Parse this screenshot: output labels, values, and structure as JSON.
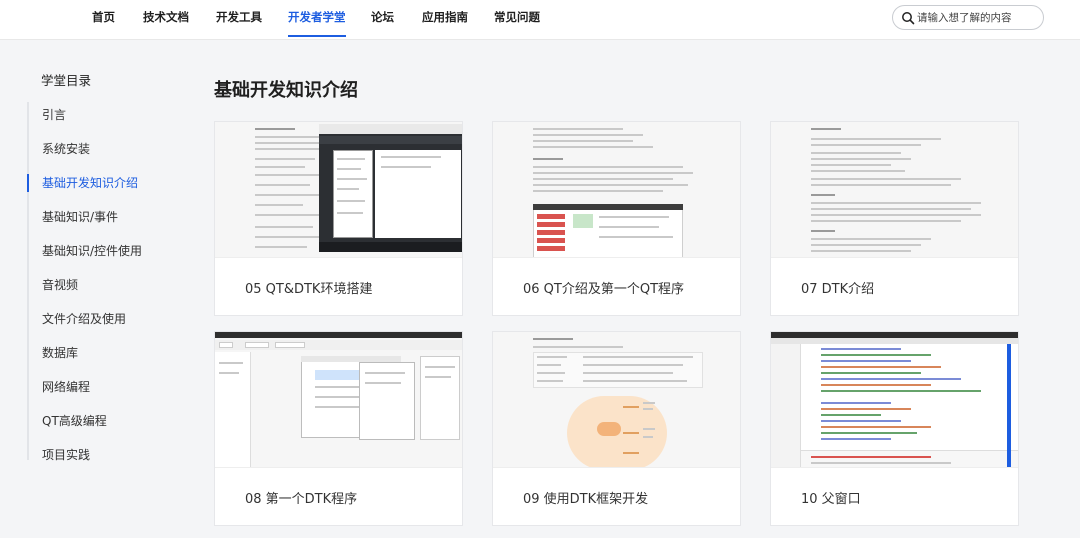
{
  "nav": {
    "items": [
      {
        "label": "首页",
        "active": false
      },
      {
        "label": "技术文档",
        "active": false
      },
      {
        "label": "开发工具",
        "active": false
      },
      {
        "label": "开发者学堂",
        "active": true
      },
      {
        "label": "论坛",
        "active": false
      },
      {
        "label": "应用指南",
        "active": false
      },
      {
        "label": "常见问题",
        "active": false
      }
    ],
    "search": {
      "placeholder": "请输入想了解的内容",
      "value": ""
    }
  },
  "sidebar": {
    "title": "学堂目录",
    "items": [
      {
        "label": "引言",
        "active": false
      },
      {
        "label": "系统安装",
        "active": false
      },
      {
        "label": "基础开发知识介绍",
        "active": true
      },
      {
        "label": "基础知识/事件",
        "active": false
      },
      {
        "label": "基础知识/控件使用",
        "active": false
      },
      {
        "label": "音视频",
        "active": false
      },
      {
        "label": "文件介绍及使用",
        "active": false
      },
      {
        "label": "数据库",
        "active": false
      },
      {
        "label": "网络编程",
        "active": false
      },
      {
        "label": "QT高级编程",
        "active": false
      },
      {
        "label": "项目实践",
        "active": false
      }
    ]
  },
  "main": {
    "title": "基础开发知识介绍",
    "cards": [
      {
        "label": "05 QT&DTK环境搭建"
      },
      {
        "label": "06 QT介绍及第一个QT程序"
      },
      {
        "label": "07 DTK介绍"
      },
      {
        "label": "08 第一个DTK程序"
      },
      {
        "label": "09 使用DTK框架开发"
      },
      {
        "label": "10 父窗口"
      }
    ]
  },
  "colors": {
    "accent": "#1d5de0",
    "background": "#f4f5f7",
    "card": "#ffffff"
  },
  "icons": {
    "search": "search-icon"
  }
}
